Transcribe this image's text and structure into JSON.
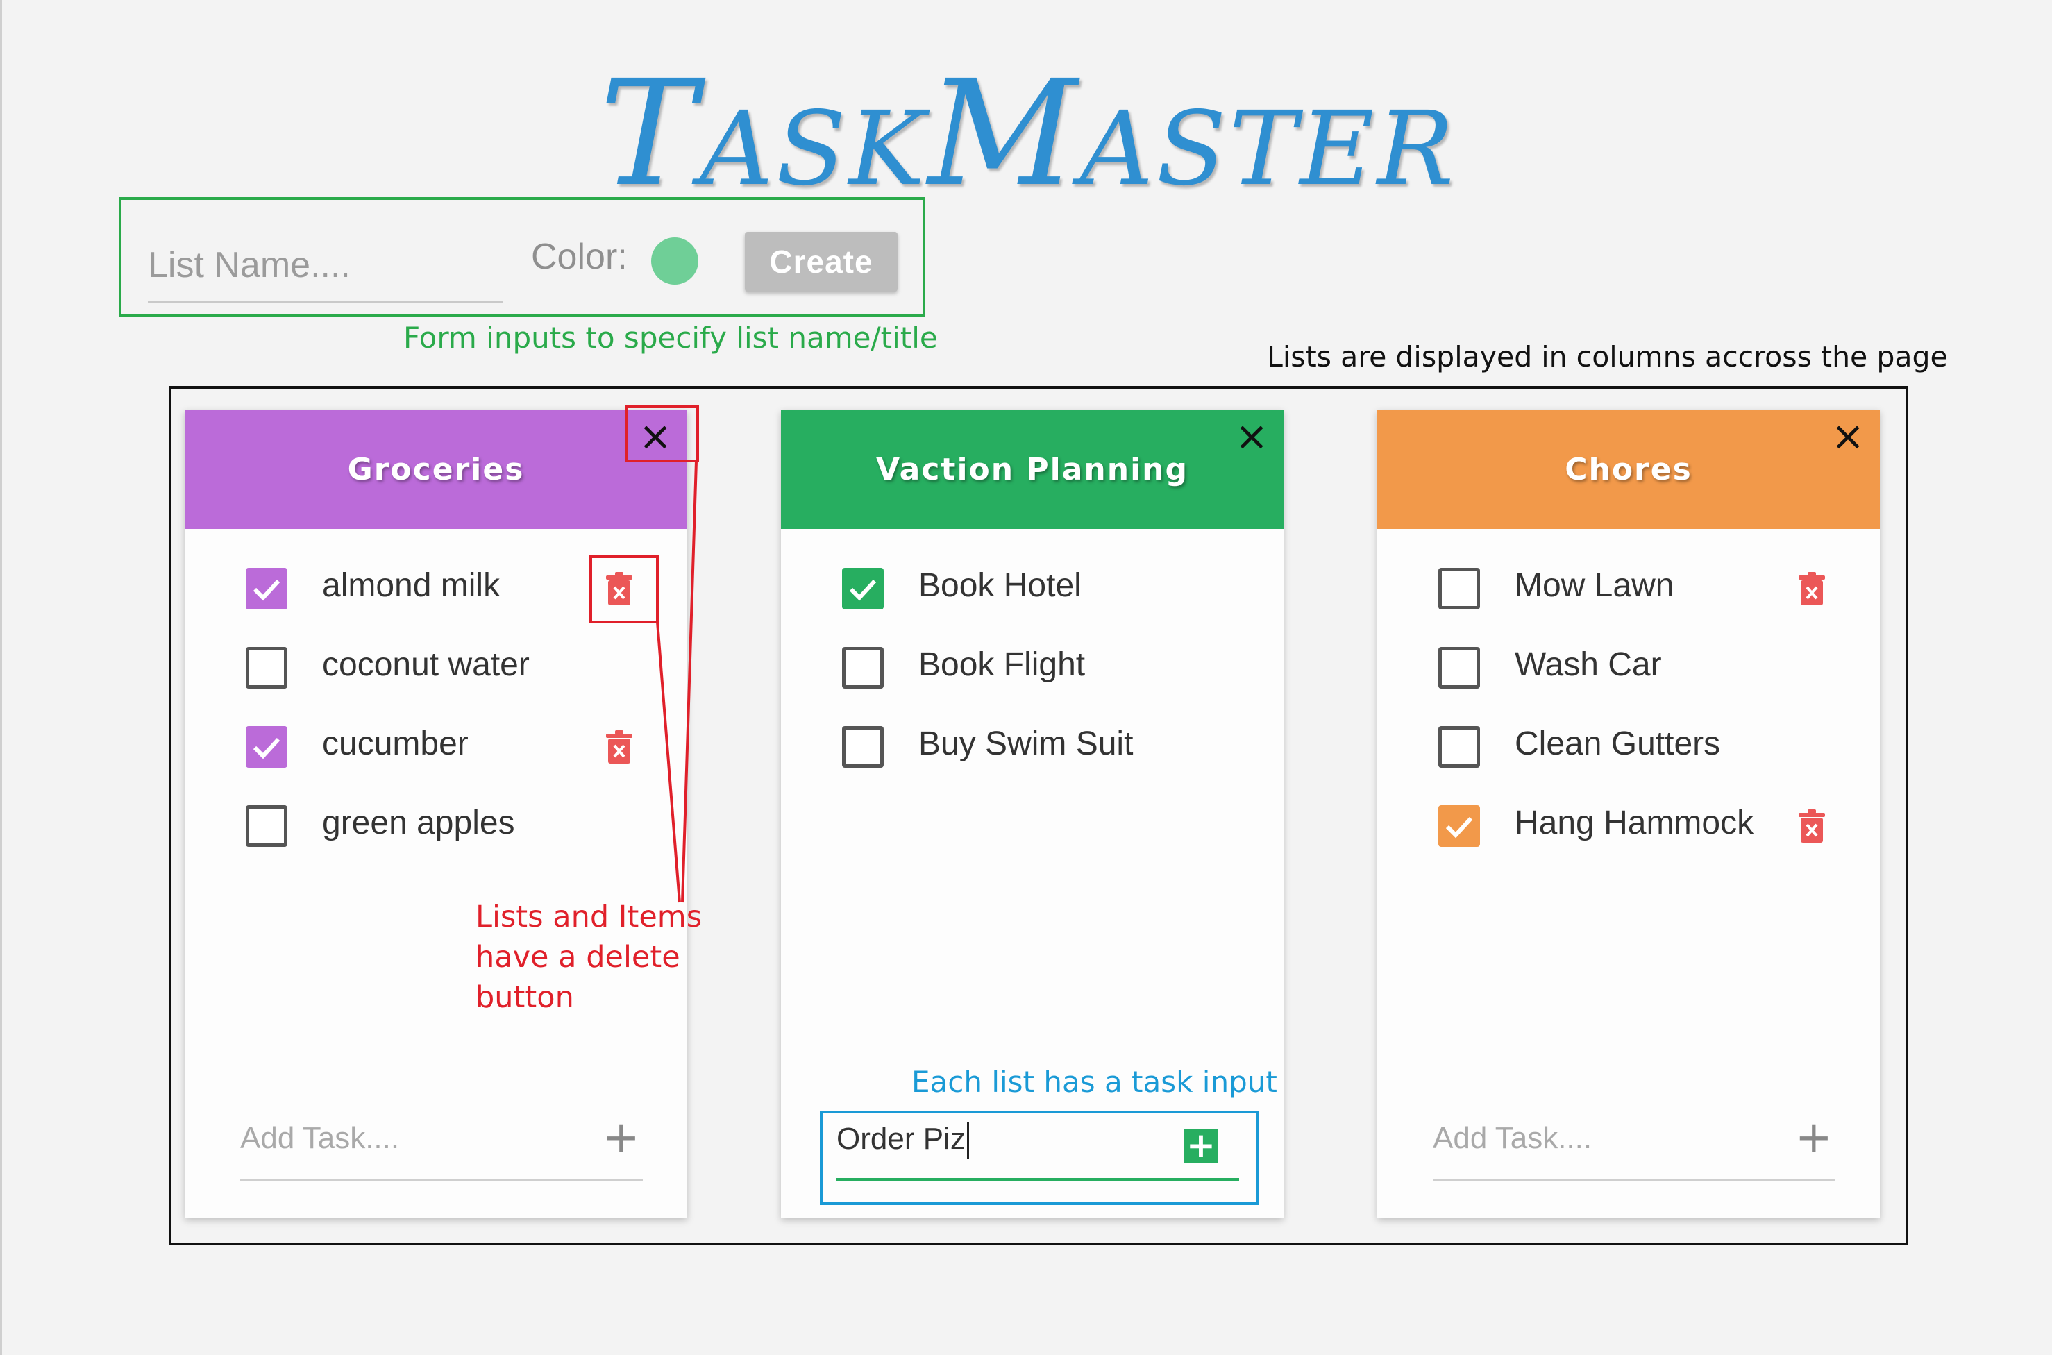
{
  "app": {
    "title": "TaskMaster"
  },
  "form": {
    "list_name_placeholder": "List Name....",
    "color_label": "Color:",
    "color_value": "#6fcf97",
    "create_label": "Create"
  },
  "annotations": {
    "form_note": "Form inputs to specify list name/title",
    "columns_note": "Lists are displayed in columns accross the page",
    "delete_note_line1": "Lists and Items",
    "delete_note_line2": "have a delete",
    "delete_note_line3": "button",
    "task_input_note": "Each list has a task input"
  },
  "lists": [
    {
      "title": "Groceries",
      "color": "#bb6bd9",
      "close_icon": "×",
      "items": [
        {
          "text": "almond milk",
          "checked": true,
          "trash": true
        },
        {
          "text": "coconut water",
          "checked": false,
          "trash": false
        },
        {
          "text": "cucumber",
          "checked": true,
          "trash": true
        },
        {
          "text": "green apples",
          "checked": false,
          "trash": false
        }
      ],
      "add_placeholder": "Add Task....",
      "add_value": "",
      "add_icon": "+"
    },
    {
      "title": "Vaction Planning",
      "color": "#27ae60",
      "close_icon": "×",
      "items": [
        {
          "text": "Book Hotel",
          "checked": true,
          "trash": false
        },
        {
          "text": "Book Flight",
          "checked": false,
          "trash": false
        },
        {
          "text": "Buy Swim Suit",
          "checked": false,
          "trash": false
        }
      ],
      "add_placeholder": "Add Task....",
      "add_value": "Order Piz",
      "add_icon": "+"
    },
    {
      "title": "Chores",
      "color": "#f2994a",
      "close_icon": "×",
      "items": [
        {
          "text": "Mow Lawn",
          "checked": false,
          "trash": true
        },
        {
          "text": "Wash Car",
          "checked": false,
          "trash": false
        },
        {
          "text": "Clean Gutters",
          "checked": false,
          "trash": false
        },
        {
          "text": "Hang Hammock",
          "checked": true,
          "trash": true
        }
      ],
      "add_placeholder": "Add Task....",
      "add_value": "",
      "add_icon": "+"
    }
  ],
  "icons": {
    "close": "close-icon",
    "trash": "trash-icon",
    "check": "check-icon",
    "plus": "plus-icon"
  }
}
